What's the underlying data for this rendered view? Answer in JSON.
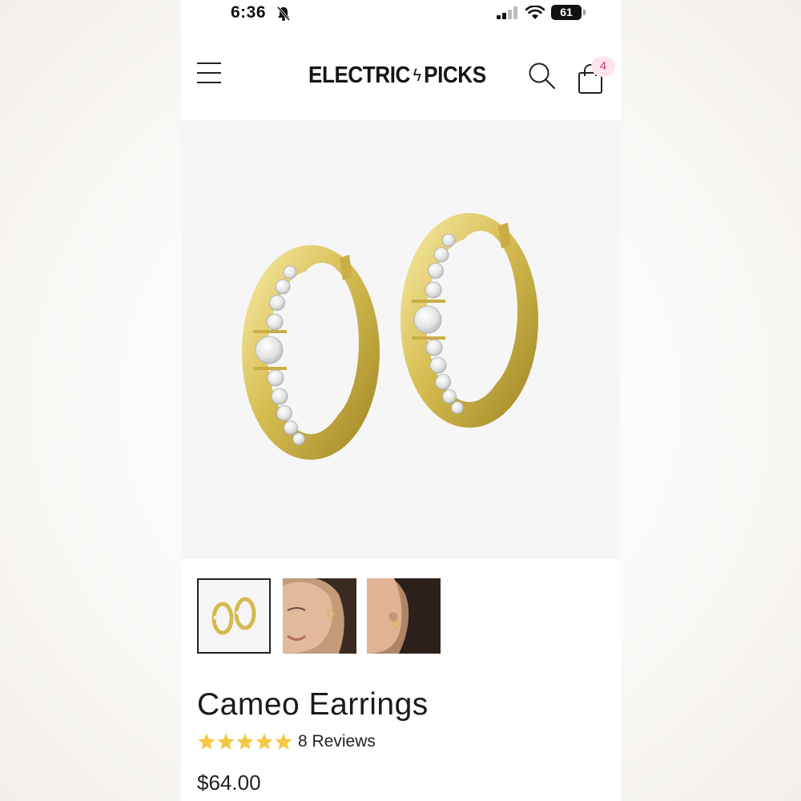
{
  "status_bar": {
    "time": "6:36",
    "battery": "61"
  },
  "header": {
    "brand_left": "ELECTRIC",
    "brand_bolt": "ϟ",
    "brand_right": "PICKS",
    "cart_count": "4"
  },
  "icons": [
    "bell-muted-icon",
    "signal-icon",
    "wifi-icon",
    "battery-icon",
    "menu-icon",
    "search-icon",
    "shopping-bag-icon",
    "star-icon"
  ],
  "product": {
    "title": "Cameo Earrings",
    "rating": 5,
    "reviews_label": "8 Reviews",
    "price": "$64.00"
  },
  "colors": {
    "gold": "#d8c15a",
    "star": "#f5c746",
    "badge_bg": "#fde4ee",
    "badge_text": "#d2336b"
  }
}
